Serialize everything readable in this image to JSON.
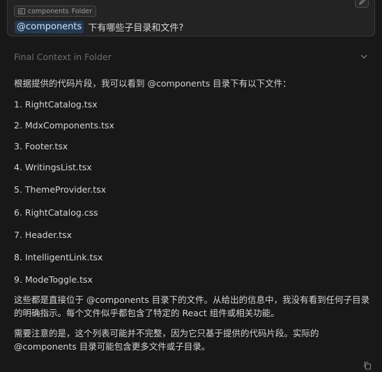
{
  "context_card": {
    "chip_label": "components",
    "chip_type": "Folder",
    "mention": "@components",
    "question": "下有哪些子目录和文件?"
  },
  "section": {
    "title": "Final Context in Folder"
  },
  "answer": {
    "intro": "根据提供的代码片段，我可以看到 @components 目录下有以下文件：",
    "files": [
      "1. RightCatalog.tsx",
      "2. MdxComponents.tsx",
      "3. Footer.tsx",
      "4. WritingsList.tsx",
      "5. ThemeProvider.tsx",
      "6. RightCatalog.css",
      "7. Header.tsx",
      "8. IntelligentLink.tsx",
      "9. ModeToggle.tsx"
    ],
    "para1": "这些都是直接位于 @components 目录下的文件。从给出的信息中，我没有看到任何子目录的明确指示。每个文件似乎都包含了特定的 React 组件或相关功能。",
    "para2": "需要注意的是，这个列表可能并不完整，因为它只基于提供的代码片段。实际的 @components 目录可能包含更多文件或子目录。"
  },
  "icons": {
    "chip": "folder-icon",
    "edit": "pencil-icon",
    "section_toggle": "chevron-down-icon",
    "copy": "copy-icon"
  }
}
